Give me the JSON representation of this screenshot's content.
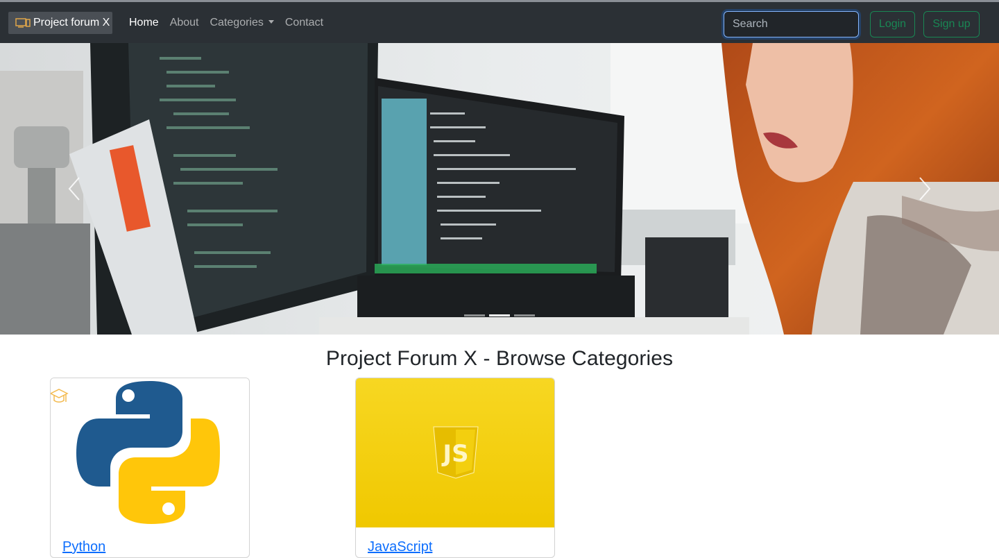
{
  "navbar": {
    "brand": "Project forum X",
    "links": [
      {
        "label": "Home",
        "active": true
      },
      {
        "label": "About",
        "active": false
      },
      {
        "label": "Categories",
        "active": false,
        "dropdown": true
      },
      {
        "label": "Contact",
        "active": false
      }
    ],
    "search": {
      "placeholder": "Search",
      "value": ""
    },
    "login_label": "Login",
    "signup_label": "Sign up"
  },
  "carousel": {
    "slide_count": 3,
    "active_index": 1
  },
  "main": {
    "title": "Project Forum X - Browse Categories",
    "categories": [
      {
        "name": "Python",
        "icon": "python-logo"
      },
      {
        "name": "JavaScript",
        "icon": "js-logo"
      }
    ]
  },
  "colors": {
    "navbar_bg": "#2b3035",
    "success": "#198754",
    "link": "#0d6efd",
    "python_blue": "#1f5a8f",
    "python_yellow": "#ffc60a",
    "js_yellow": "#f5d00e"
  }
}
